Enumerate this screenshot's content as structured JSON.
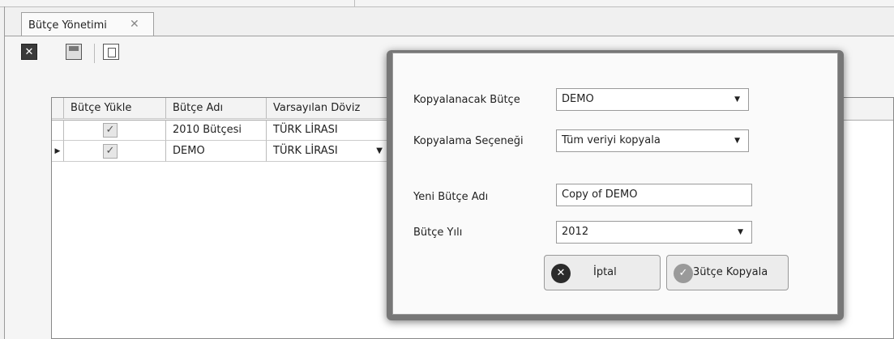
{
  "tab": {
    "title": "Bütçe Yönetimi",
    "close_glyph": "✕"
  },
  "toolbar": {
    "close_icon": "close-icon",
    "save_icon": "save-icon",
    "copy_icon": "copy-icon"
  },
  "grid": {
    "columns": [
      "Bütçe Yükle",
      "Bütçe Adı",
      "Varsayılan Döviz"
    ],
    "rows": [
      {
        "load_checked": true,
        "name": "2010 Bütçesi",
        "currency": "TÜRK LİRASI",
        "current": false
      },
      {
        "load_checked": true,
        "name": "DEMO",
        "currency": "TÜRK LİRASI",
        "current": true
      }
    ],
    "check_glyph": "✓",
    "row_indicator_glyph": "▶",
    "dropdown_glyph": "▼"
  },
  "dialog": {
    "source_label": "Kopyalanacak Bütçe",
    "source_value": "DEMO",
    "option_label": "Kopyalama Seçeneği",
    "option_value": "Tüm veriyi kopyala",
    "newname_label": "Yeni Bütçe Adı",
    "newname_value": "Copy of DEMO",
    "year_label": "Bütçe Yılı",
    "year_value": "2012",
    "dropdown_glyph": "▼",
    "cancel_label": "İptal",
    "cancel_glyph": "✕",
    "copy_label": "3ütçe Kopyala",
    "copy_glyph": "✓"
  }
}
